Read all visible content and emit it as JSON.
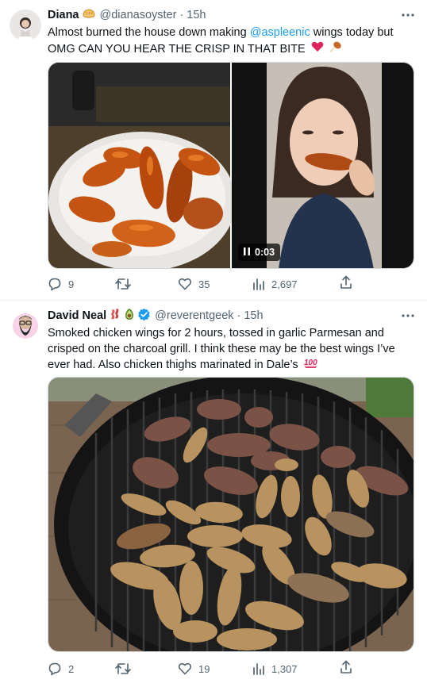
{
  "tweets": [
    {
      "name": "Diana",
      "handle": "@dianasoyster",
      "dot": "·",
      "time": "15h",
      "text_before": "Almost burned the house down making ",
      "mention": "@aspleenic",
      "text_after": " wings today but OMG CAN YOU HEAR THE CRISP IN THAT BITE",
      "video_time": "0:03",
      "replies": "9",
      "retweets": "",
      "likes": "35",
      "views": "2,697"
    },
    {
      "name": "David Neal",
      "handle": "@reverentgeek",
      "dot": "·",
      "time": "15h",
      "text": "Smoked chicken wings for 2 hours, tossed in garlic Parmesan and crisped on the charcoal grill. I think these may be the best wings I’ve ever had. Also chicken thighs marinated in Dale’s",
      "replies": "2",
      "retweets": "",
      "likes": "19",
      "views": "1,307",
      "verified": true
    }
  ],
  "colors": {
    "accent": "#1d9bf0",
    "secondary_text": "#536471",
    "border": "#eff3f4"
  },
  "icons": [
    "more-icon",
    "reply-icon",
    "retweet-icon",
    "like-icon",
    "views-icon",
    "share-icon",
    "verified-badge-icon",
    "pause-icon",
    "heart-emoji",
    "drumstick-emoji",
    "bread-emoji",
    "bacon-emoji",
    "avocado-emoji",
    "hundred-emoji"
  ]
}
